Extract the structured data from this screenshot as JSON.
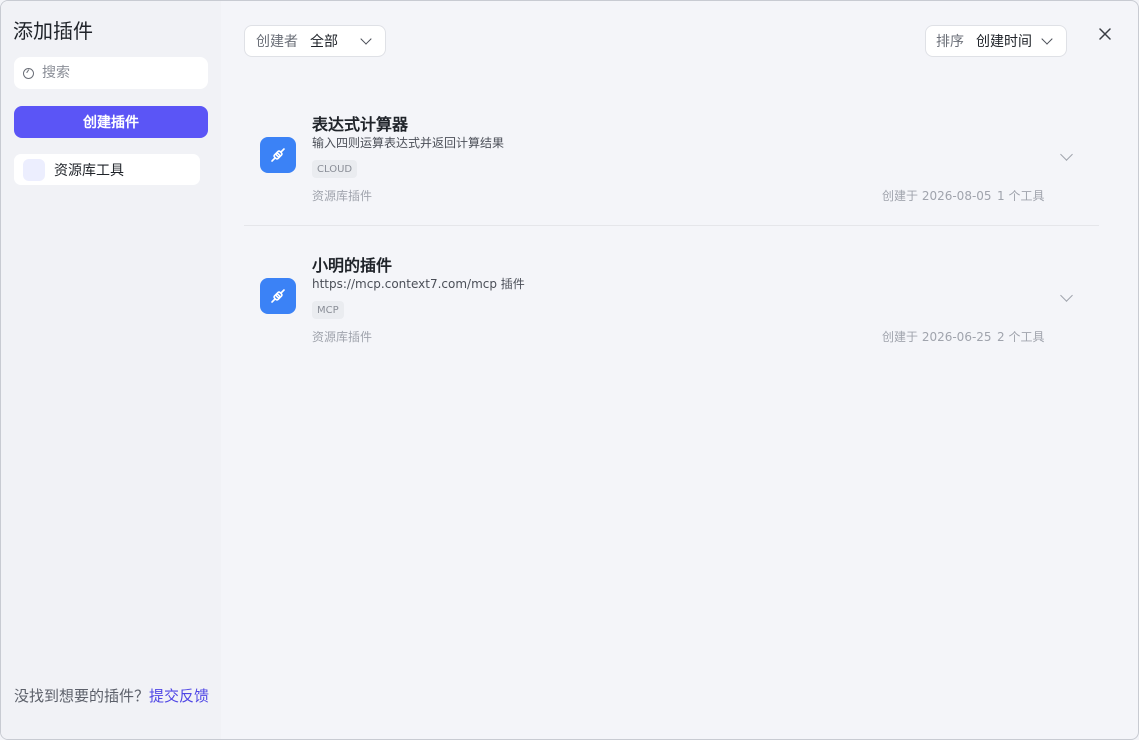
{
  "sidebar": {
    "title": "添加插件",
    "search_placeholder": "搜索",
    "create_button": "创建插件",
    "categories": [
      {
        "label": "资源库工具"
      }
    ],
    "feedback_text": "没找到想要的插件？",
    "feedback_link": "提交反馈"
  },
  "filters": {
    "creator_label": "创建者",
    "creator_value": "全部",
    "sort_label": "排序",
    "sort_value": "创建时间"
  },
  "plugins": [
    {
      "name": "表达式计算器",
      "description": "输入四则运算表达式并返回计算结果",
      "tag": "CLOUD",
      "source": "资源库插件",
      "created": "创建于 2026-08-05",
      "tools": "1 个工具"
    },
    {
      "name": "小明的插件",
      "description": "https://mcp.context7.com/mcp 插件",
      "tag": "MCP",
      "source": "资源库插件",
      "created": "创建于 2026-06-25",
      "tools": "2 个工具"
    }
  ],
  "colors": {
    "accent": "#5b55f6",
    "plugin_icon": "#3b82f6",
    "link": "#4f46e5"
  }
}
